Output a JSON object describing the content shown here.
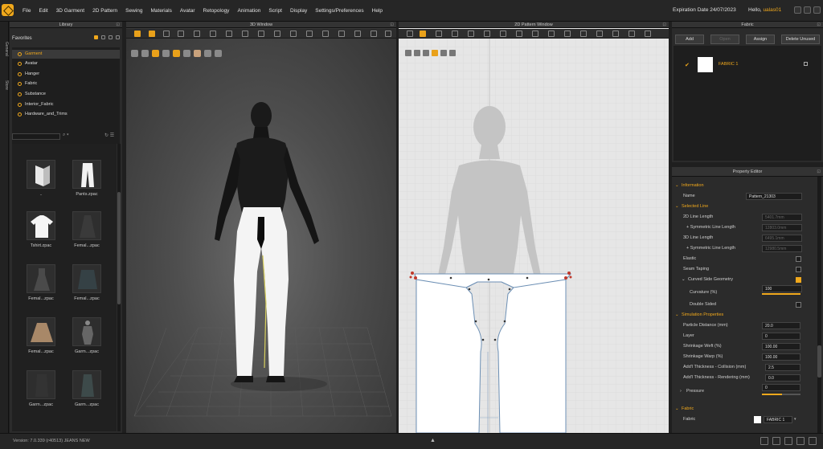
{
  "menu": [
    "File",
    "Edit",
    "3D Garment",
    "2D Pattern",
    "Sewing",
    "Materials",
    "Avatar",
    "Retopology",
    "Animation",
    "Script",
    "Display",
    "Settings/Preferences",
    "Help"
  ],
  "header": {
    "expiration": "Expiration Date 24/07/2023",
    "hello_label": "Hello,",
    "user": "ualas01"
  },
  "left_tabs": [
    "General",
    "Store"
  ],
  "library": {
    "title": "Library",
    "favorites_label": "Favorites",
    "items": [
      "Garment",
      "Avatar",
      "Hanger",
      "Fabric",
      "Substance",
      "Interior_Fabric",
      "Hardware_and_Trims"
    ],
    "thumbnails": [
      "..",
      "Pants.zpac",
      "Tshirt.zpac",
      "Femal...zpac",
      "Femal...zpac",
      "Femal...zpac",
      "Femal...zpac",
      "Garm...zpac",
      "Garm...zpac",
      "Garm...zpac"
    ]
  },
  "window3d": {
    "title": "3D Window"
  },
  "window2d": {
    "title": "2D Pattern Window"
  },
  "fabric": {
    "title": "Fabric",
    "buttons": {
      "add": "Add",
      "open": "Open",
      "assign": "Assign",
      "delete": "Delete Unused"
    },
    "items": [
      {
        "name": "FABRIC 1"
      }
    ]
  },
  "property": {
    "title": "Property Editor",
    "information": "Information",
    "name_label": "Name",
    "name_value": "Pattern_21303",
    "selected_line": "Selected Line",
    "len2d_label": "2D Line Length",
    "len2d_value": "5401.7mm",
    "sym1_label": "+ Symmetric Line Length",
    "sym1_value": "12803.0mm",
    "len3d_label": "3D Line Length",
    "len3d_value": "6495.1mm",
    "sym2_label": "+ Symmetric Line Length",
    "sym2_value": "12980.5mm",
    "elastic_label": "Elastic",
    "seam_label": "Seam Taping",
    "curved_label": "Curved Side Geometry",
    "curvature_label": "Curvature (%)",
    "curvature_value": "100",
    "double_label": "Double Sided",
    "sim_props": "Simulation Properties",
    "particle_label": "Particle Distance (mm)",
    "particle_value": "20.0",
    "layer_label": "Layer",
    "layer_value": "0",
    "weft_label": "Shrinkage Weft (%)",
    "weft_value": "100.00",
    "warp_label": "Shrinkage Warp (%)",
    "warp_value": "100.00",
    "collision_label": "Add'l Thickness - Collision (mm)",
    "collision_value": "2.5",
    "rendering_label": "Add'l Thickness - Rendering (mm)",
    "rendering_value": "0.0",
    "pressure_label": "Pressure",
    "pressure_value": "0",
    "fabric_section": "Fabric",
    "fabric_label": "Fabric",
    "fabric_value": "FABRIC 1"
  },
  "status": {
    "version": "Version:   7.0.339 (r40513)   JEANS NEW"
  },
  "colors": {
    "accent": "#f0a81c"
  }
}
